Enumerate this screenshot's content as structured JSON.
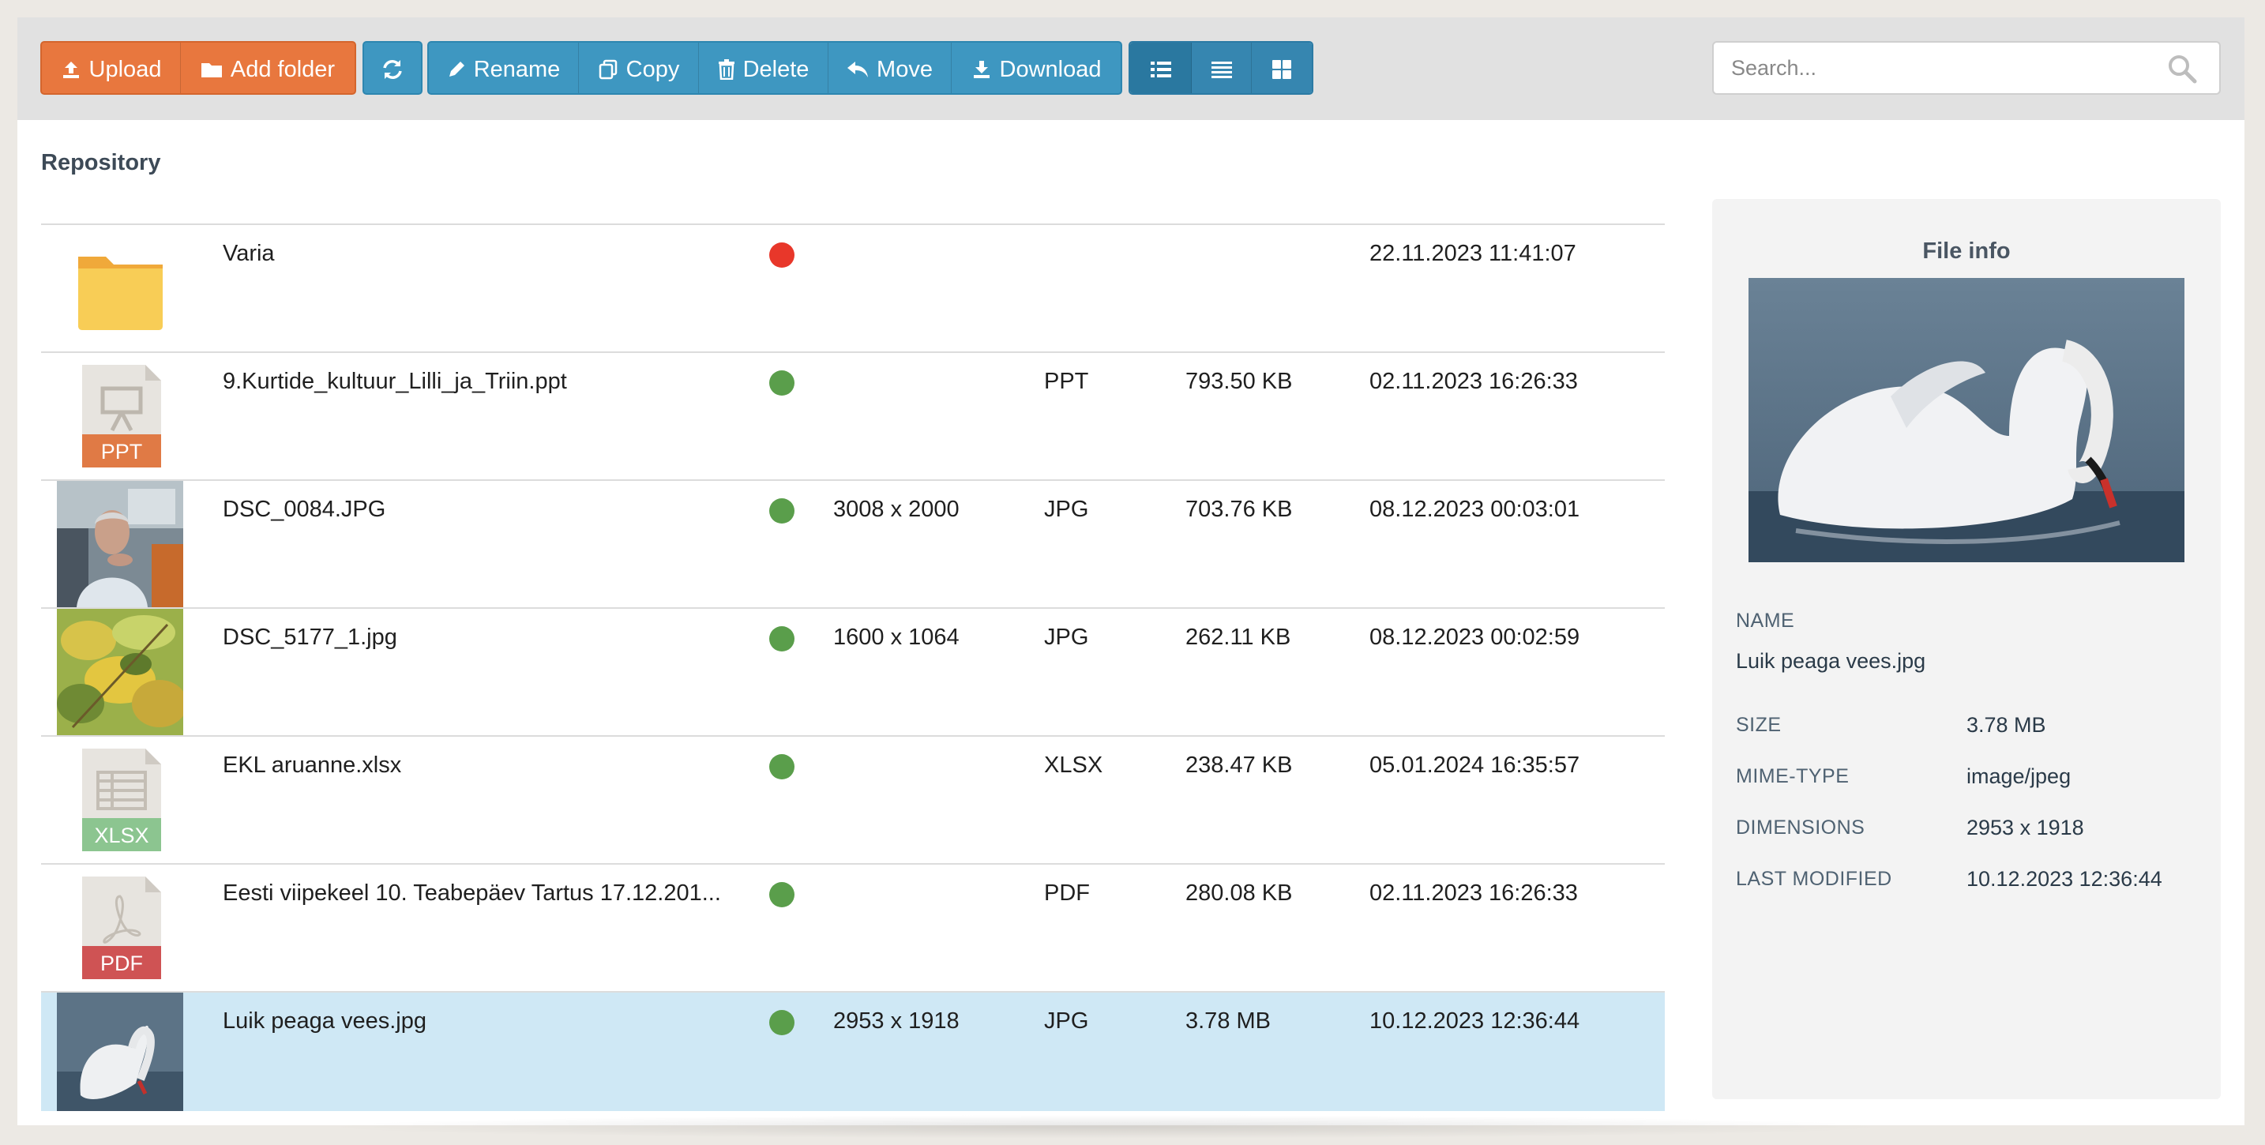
{
  "toolbar": {
    "upload": "Upload",
    "add_folder": "Add folder",
    "rename": "Rename",
    "copy": "Copy",
    "delete": "Delete",
    "move": "Move",
    "download": "Download"
  },
  "search": {
    "placeholder": "Search..."
  },
  "repository": {
    "title": "Repository"
  },
  "files": [
    {
      "name": "Varia",
      "status": "red",
      "dimensions": "",
      "type": "",
      "size": "",
      "modified": "22.11.2023 11:41:07",
      "thumb": "folder-icon"
    },
    {
      "name": "9.Kurtide_kultuur_Lilli_ja_Triin.ppt",
      "status": "green",
      "dimensions": "",
      "type": "PPT",
      "size": "793.50 KB",
      "modified": "02.11.2023 16:26:33",
      "thumb": "ppt-file-icon",
      "badge": "PPT"
    },
    {
      "name": "DSC_0084.JPG",
      "status": "green",
      "dimensions": "3008 x 2000",
      "type": "JPG",
      "size": "703.76 KB",
      "modified": "08.12.2023 00:03:01",
      "thumb": "photo-man-thumbnail"
    },
    {
      "name": "DSC_5177_1.jpg",
      "status": "green",
      "dimensions": "1600 x 1064",
      "type": "JPG",
      "size": "262.11 KB",
      "modified": "08.12.2023 00:02:59",
      "thumb": "photo-leaves-thumbnail"
    },
    {
      "name": "EKL aruanne.xlsx",
      "status": "green",
      "dimensions": "",
      "type": "XLSX",
      "size": "238.47 KB",
      "modified": "05.01.2024 16:35:57",
      "thumb": "xlsx-file-icon",
      "badge": "XLSX"
    },
    {
      "name": "Eesti viipekeel 10. Teabepäev Tartus 17.12.201...",
      "status": "green",
      "dimensions": "",
      "type": "PDF",
      "size": "280.08 KB",
      "modified": "02.11.2023 16:26:33",
      "thumb": "pdf-file-icon",
      "badge": "PDF"
    },
    {
      "name": "Luik peaga vees.jpg",
      "status": "green",
      "dimensions": "2953 x 1918",
      "type": "JPG",
      "size": "3.78 MB",
      "modified": "10.12.2023 12:36:44",
      "thumb": "photo-swan-thumbnail"
    }
  ],
  "file_info": {
    "title": "File info",
    "name_label": "NAME",
    "name": "Luik peaga vees.jpg",
    "size_label": "SIZE",
    "size": "3.78 MB",
    "mime_label": "MIME-TYPE",
    "mime": "image/jpeg",
    "dimensions_label": "DIMENSIONS",
    "dimensions": "2953 x 1918",
    "modified_label": "LAST MODIFIED",
    "modified": "10.12.2023 12:36:44"
  },
  "colors": {
    "orange": "#e8773e",
    "blue": "#3e97c1",
    "status_green": "#5a9e4b",
    "status_red": "#e8372a",
    "selected_row": "#cfe8f5"
  }
}
